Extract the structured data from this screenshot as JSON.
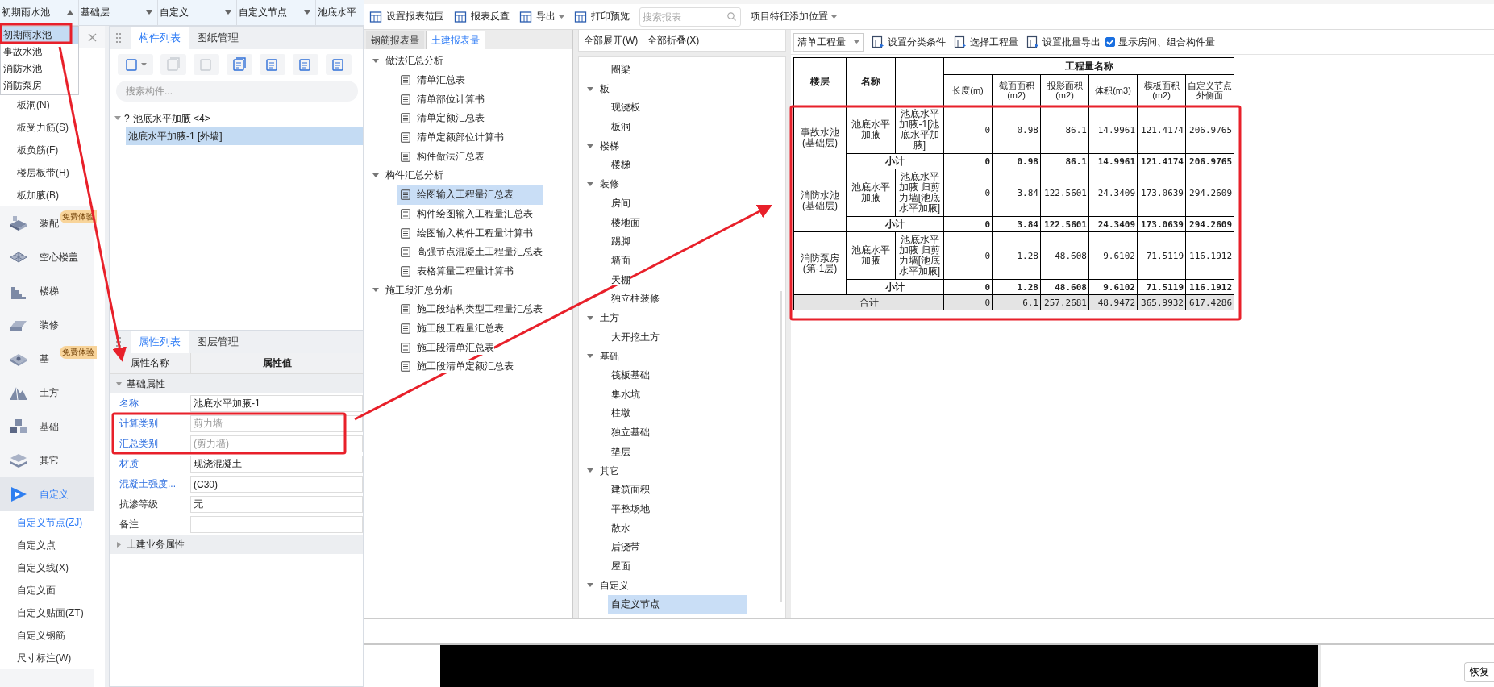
{
  "top_bar": {
    "selects": [
      {
        "label": "初期雨水池",
        "expanded": true
      },
      {
        "label": "基础层",
        "expanded": false
      },
      {
        "label": "自定义",
        "expanded": false
      },
      {
        "label": "自定义节点",
        "expanded": false
      },
      {
        "label": "池底水平"
      }
    ]
  },
  "floor_dropdown": {
    "options": [
      {
        "label": "初期雨水池",
        "selected": true
      },
      {
        "label": "事故水池",
        "selected": false
      },
      {
        "label": "消防水池",
        "selected": false
      },
      {
        "label": "消防泵房",
        "selected": false
      }
    ]
  },
  "sidebar": {
    "items": [
      {
        "kind": "sub",
        "label": "板洞(N)",
        "selected": false
      },
      {
        "kind": "sub",
        "label": "板受力筋(S)",
        "selected": false
      },
      {
        "kind": "sub",
        "label": "板负筋(F)",
        "selected": false
      },
      {
        "kind": "sub",
        "label": "楼层板带(H)",
        "selected": false
      },
      {
        "kind": "sub",
        "label": "板加腋(B)",
        "selected": false
      },
      {
        "kind": "category",
        "label": "装配",
        "badge": "免费体验",
        "selected": false
      },
      {
        "kind": "category",
        "label": "空心楼盖",
        "selected": false
      },
      {
        "kind": "category",
        "label": "楼梯",
        "selected": false
      },
      {
        "kind": "category",
        "label": "装修",
        "selected": false
      },
      {
        "kind": "category",
        "label": "基",
        "badge": "免费体验",
        "selected": false
      },
      {
        "kind": "category",
        "label": "土方",
        "selected": false
      },
      {
        "kind": "category",
        "label": "基础",
        "selected": false
      },
      {
        "kind": "category",
        "label": "其它",
        "selected": false
      },
      {
        "kind": "category",
        "label": "自定义",
        "selected": true
      },
      {
        "kind": "sub",
        "label": "自定义节点(ZJ)",
        "selected": true
      },
      {
        "kind": "sub",
        "label": "自定义点",
        "selected": false
      },
      {
        "kind": "sub",
        "label": "自定义线(X)",
        "selected": false
      },
      {
        "kind": "sub",
        "label": "自定义面",
        "selected": false
      },
      {
        "kind": "sub",
        "label": "自定义贴面(ZT)",
        "selected": false
      },
      {
        "kind": "sub",
        "label": "自定义钢筋",
        "selected": false
      },
      {
        "kind": "sub",
        "label": "尺寸标注(W)",
        "selected": false
      }
    ]
  },
  "component_panel": {
    "tabs": [
      {
        "label": "构件列表",
        "selected": true
      },
      {
        "label": "图纸管理",
        "selected": false
      }
    ],
    "toolbar": [
      {
        "disabled": false,
        "menu": true
      },
      {
        "disabled": true
      },
      {
        "disabled": true
      },
      {
        "disabled": false
      },
      {
        "disabled": false
      },
      {
        "disabled": false
      },
      {
        "disabled": false
      }
    ],
    "search": {
      "placeholder": "搜索构件..."
    },
    "tree": {
      "marker": "?",
      "label": "池底水平加腋 <4>",
      "expanded": true,
      "children": [
        {
          "label": "池底水平加腋-1 [外墙]",
          "selected": true
        }
      ]
    }
  },
  "properties_panel": {
    "tabs": [
      {
        "label": "属性列表",
        "selected": true
      },
      {
        "label": "图层管理",
        "selected": false
      }
    ],
    "columns": [
      "属性名称",
      "属性值"
    ],
    "groups": [
      {
        "label": "基础属性",
        "expanded": true,
        "rows": [
          {
            "name": "名称",
            "linked": true,
            "value": "池底水平加腋-1",
            "disabled": false
          },
          {
            "name": "计算类别",
            "linked": true,
            "value": "剪力墙",
            "disabled": true
          },
          {
            "name": "汇总类别",
            "linked": true,
            "value": "(剪力墙)",
            "disabled": true
          },
          {
            "name": "材质",
            "linked": true,
            "value": "现浇混凝土",
            "disabled": false
          },
          {
            "name": "混凝土强度...",
            "linked": true,
            "value": "(C30)",
            "disabled": false
          },
          {
            "name": "抗渗等级",
            "linked": false,
            "value": "无",
            "disabled": false
          },
          {
            "name": "备注",
            "linked": false,
            "disabled": false
          }
        ]
      },
      {
        "label": "土建业务属性",
        "expanded": false
      }
    ]
  },
  "report_window": {
    "toolbar": [
      {
        "label": "设置报表范围"
      },
      {
        "label": "报表反查"
      },
      {
        "label": "导出",
        "menu": true
      },
      {
        "label": "打印预览"
      }
    ],
    "search": {
      "placeholder": "搜索报表"
    },
    "feature_position": {
      "label": "项目特征添加位置"
    },
    "report_tabs": [
      {
        "label": "钢筋报表量",
        "selected": false
      },
      {
        "label": "土建报表量",
        "selected": true
      }
    ],
    "report_tree": [
      {
        "label": "做法汇总分析",
        "expanded": true,
        "children": [
          {
            "label": "清单汇总表",
            "selected": false
          },
          {
            "label": "清单部位计算书",
            "selected": false
          },
          {
            "label": "清单定额汇总表",
            "selected": false
          },
          {
            "label": "清单定额部位计算书",
            "selected": false
          },
          {
            "label": "构件做法汇总表",
            "selected": false
          }
        ]
      },
      {
        "label": "构件汇总分析",
        "expanded": true,
        "children": [
          {
            "label": "绘图输入工程量汇总表",
            "selected": true
          },
          {
            "label": "构件绘图输入工程量汇总表",
            "selected": false
          },
          {
            "label": "绘图输入构件工程量计算书",
            "selected": false
          },
          {
            "label": "高强节点混凝土工程量汇总表",
            "selected": false
          },
          {
            "label": "表格算量工程量计算书",
            "selected": false
          }
        ]
      },
      {
        "label": "施工段汇总分析",
        "expanded": true,
        "children": [
          {
            "label": "施工段结构类型工程量汇总表",
            "selected": false
          },
          {
            "label": "施工段工程量汇总表",
            "selected": false
          },
          {
            "label": "施工段清单汇总表",
            "selected": false
          },
          {
            "label": "施工段清单定额汇总表",
            "selected": false
          }
        ]
      }
    ],
    "outline_actions": [
      "全部展开(W)",
      "全部折叠(X)"
    ],
    "outline": [
      {
        "children": [
          {
            "label": "圈梁",
            "selected": false
          }
        ]
      },
      {
        "label": "板",
        "expanded": true,
        "children": [
          {
            "label": "现浇板",
            "selected": false
          },
          {
            "label": "板洞",
            "selected": false
          }
        ]
      },
      {
        "label": "楼梯",
        "expanded": true,
        "children": [
          {
            "label": "楼梯",
            "selected": false
          }
        ]
      },
      {
        "label": "装修",
        "expanded": true,
        "children": [
          {
            "label": "房间",
            "selected": false
          },
          {
            "label": "楼地面",
            "selected": false
          },
          {
            "label": "踢脚",
            "selected": false
          },
          {
            "label": "墙面",
            "selected": false
          },
          {
            "label": "天棚",
            "selected": false
          },
          {
            "label": "独立柱装修",
            "selected": false
          }
        ]
      },
      {
        "label": "土方",
        "expanded": true,
        "children": [
          {
            "label": "大开挖土方",
            "selected": false
          }
        ]
      },
      {
        "label": "基础",
        "expanded": true,
        "children": [
          {
            "label": "筏板基础",
            "selected": false
          },
          {
            "label": "集水坑",
            "selected": false
          },
          {
            "label": "柱墩",
            "selected": false
          },
          {
            "label": "独立基础",
            "selected": false
          },
          {
            "label": "垫层",
            "selected": false
          }
        ]
      },
      {
        "label": "其它",
        "expanded": true,
        "children": [
          {
            "label": "建筑面积",
            "selected": false
          },
          {
            "label": "平整场地",
            "selected": false
          },
          {
            "label": "散水",
            "selected": false
          },
          {
            "label": "后浇带",
            "selected": false
          },
          {
            "label": "屋面",
            "selected": false
          }
        ]
      },
      {
        "label": "自定义",
        "expanded": true,
        "children": [
          {
            "label": "自定义节点",
            "selected": true
          }
        ]
      }
    ],
    "quantity_toolbar": {
      "mode": "清单工程量",
      "actions": [
        "设置分类条件",
        "选择工程量",
        "设置批量导出"
      ],
      "show_rooms": {
        "label": "显示房间、组合构件量",
        "checked": true
      }
    },
    "table": {
      "floor_header": "楼层",
      "name_header": "名称",
      "group_header": "工程量名称",
      "columns": [
        "长度(m)",
        "截面面积(m2)",
        "投影面积(m2)",
        "体积(m3)",
        "模板面积(m2)",
        "自定义节点外侧面"
      ],
      "groups": [
        {
          "floor": "事故水池(基础层)",
          "name": "池底水平加腋",
          "item": "池底水平加腋-1[池底水平加腋]",
          "values": [
            "0",
            "0.98",
            "86.1",
            "14.9961",
            "121.4174",
            "206.9765"
          ],
          "subtotal_label": "小计",
          "subtotal": [
            "0",
            "0.98",
            "86.1",
            "14.9961",
            "121.4174",
            "206.9765"
          ]
        },
        {
          "floor": "消防水池(基础层)",
          "name": "池底水平加腋",
          "item": "池底水平加腋 归剪力墙[池底水平加腋]",
          "values": [
            "0",
            "3.84",
            "122.5601",
            "24.3409",
            "173.0639",
            "294.2609"
          ],
          "subtotal_label": "小计",
          "subtotal": [
            "0",
            "3.84",
            "122.5601",
            "24.3409",
            "173.0639",
            "294.2609"
          ]
        },
        {
          "floor": "消防泵房(第-1层)",
          "name": "池底水平加腋",
          "item": "池底水平加腋 归剪力墙[池底水平加腋]",
          "values": [
            "0",
            "1.28",
            "48.608",
            "9.6102",
            "71.5119",
            "116.1912"
          ],
          "subtotal_label": "小计",
          "subtotal": [
            "0",
            "1.28",
            "48.608",
            "9.6102",
            "71.5119",
            "116.1912"
          ]
        }
      ],
      "total": {
        "label": "合计",
        "values": [
          "0",
          "6.1",
          "257.2681",
          "48.9472",
          "365.9932",
          "617.4286"
        ]
      }
    }
  },
  "bottom_panel": {
    "button": "恢复"
  }
}
